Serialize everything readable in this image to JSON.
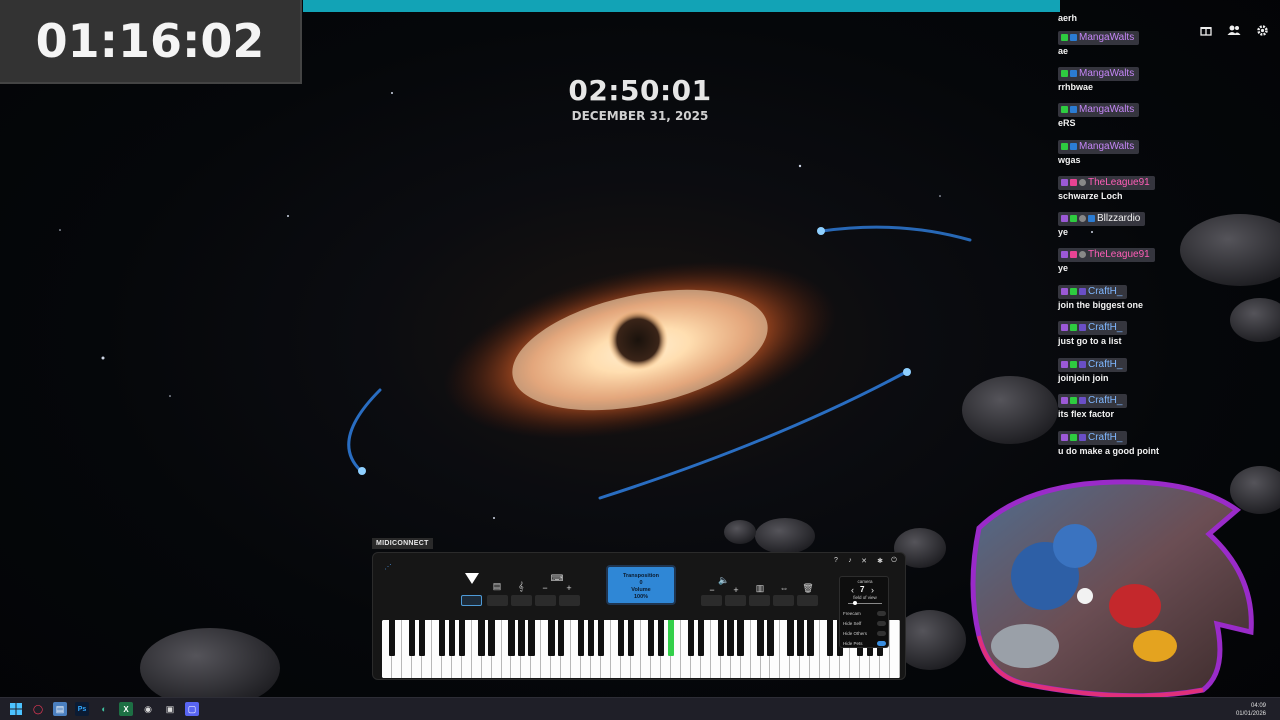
{
  "stream_timer": "01:16:02",
  "clock": {
    "time": "02:50:01",
    "date": "DECEMBER 31, 2025"
  },
  "chat": {
    "messages": [
      {
        "user": "",
        "text": "aerh",
        "color": "#c586f7"
      },
      {
        "user": "MangaWalts",
        "text": "ae",
        "color": "#c586f7"
      },
      {
        "user": "MangaWalts",
        "text": "rrhbwae",
        "color": "#c586f7"
      },
      {
        "user": "MangaWalts",
        "text": "eRS",
        "color": "#c586f7"
      },
      {
        "user": "MangaWalts",
        "text": "wgas",
        "color": "#c586f7"
      },
      {
        "user": "TheLeague91",
        "text": "schwarze Loch",
        "color": "#ff5fb8"
      },
      {
        "user": "Bllzzardio",
        "text": "ye",
        "color": "#f2f2f2"
      },
      {
        "user": "TheLeague91",
        "text": "ye",
        "color": "#ff5fb8"
      },
      {
        "user": "CraftH_",
        "text": "join the biggest one",
        "color": "#7fb7ff"
      },
      {
        "user": "CraftH_",
        "text": "just go to a list",
        "color": "#7fb7ff"
      },
      {
        "user": "CraftH_",
        "text": "joinjoin join",
        "color": "#7fb7ff"
      },
      {
        "user": "CraftH_",
        "text": "its flex factor",
        "color": "#7fb7ff"
      },
      {
        "user": "CraftH_",
        "text": "u do make a good point",
        "color": "#7fb7ff"
      }
    ]
  },
  "top_icons": [
    "gift-icon",
    "users-icon",
    "settings-icon"
  ],
  "midi": {
    "label": "MIDICONNECT",
    "display": {
      "line1": "Transposition",
      "line2": "0",
      "line3": "Volume",
      "line4": "100%"
    },
    "camera_popup": {
      "title": "camera",
      "subtitle": "field of view",
      "value": "7",
      "options": [
        {
          "label": "Freecam",
          "on": false
        },
        {
          "label": "Hide Self",
          "on": false
        },
        {
          "label": "Hide Others",
          "on": false
        },
        {
          "label": "Hide Pets",
          "on": true
        }
      ]
    },
    "pressed_key_index": 20
  },
  "taskbar": {
    "time": "04:09",
    "date": "01/01/2026"
  },
  "colors": {
    "accent": "#12a3b6",
    "display_blue": "#2f87d6",
    "pressed_key": "#34d04a"
  }
}
